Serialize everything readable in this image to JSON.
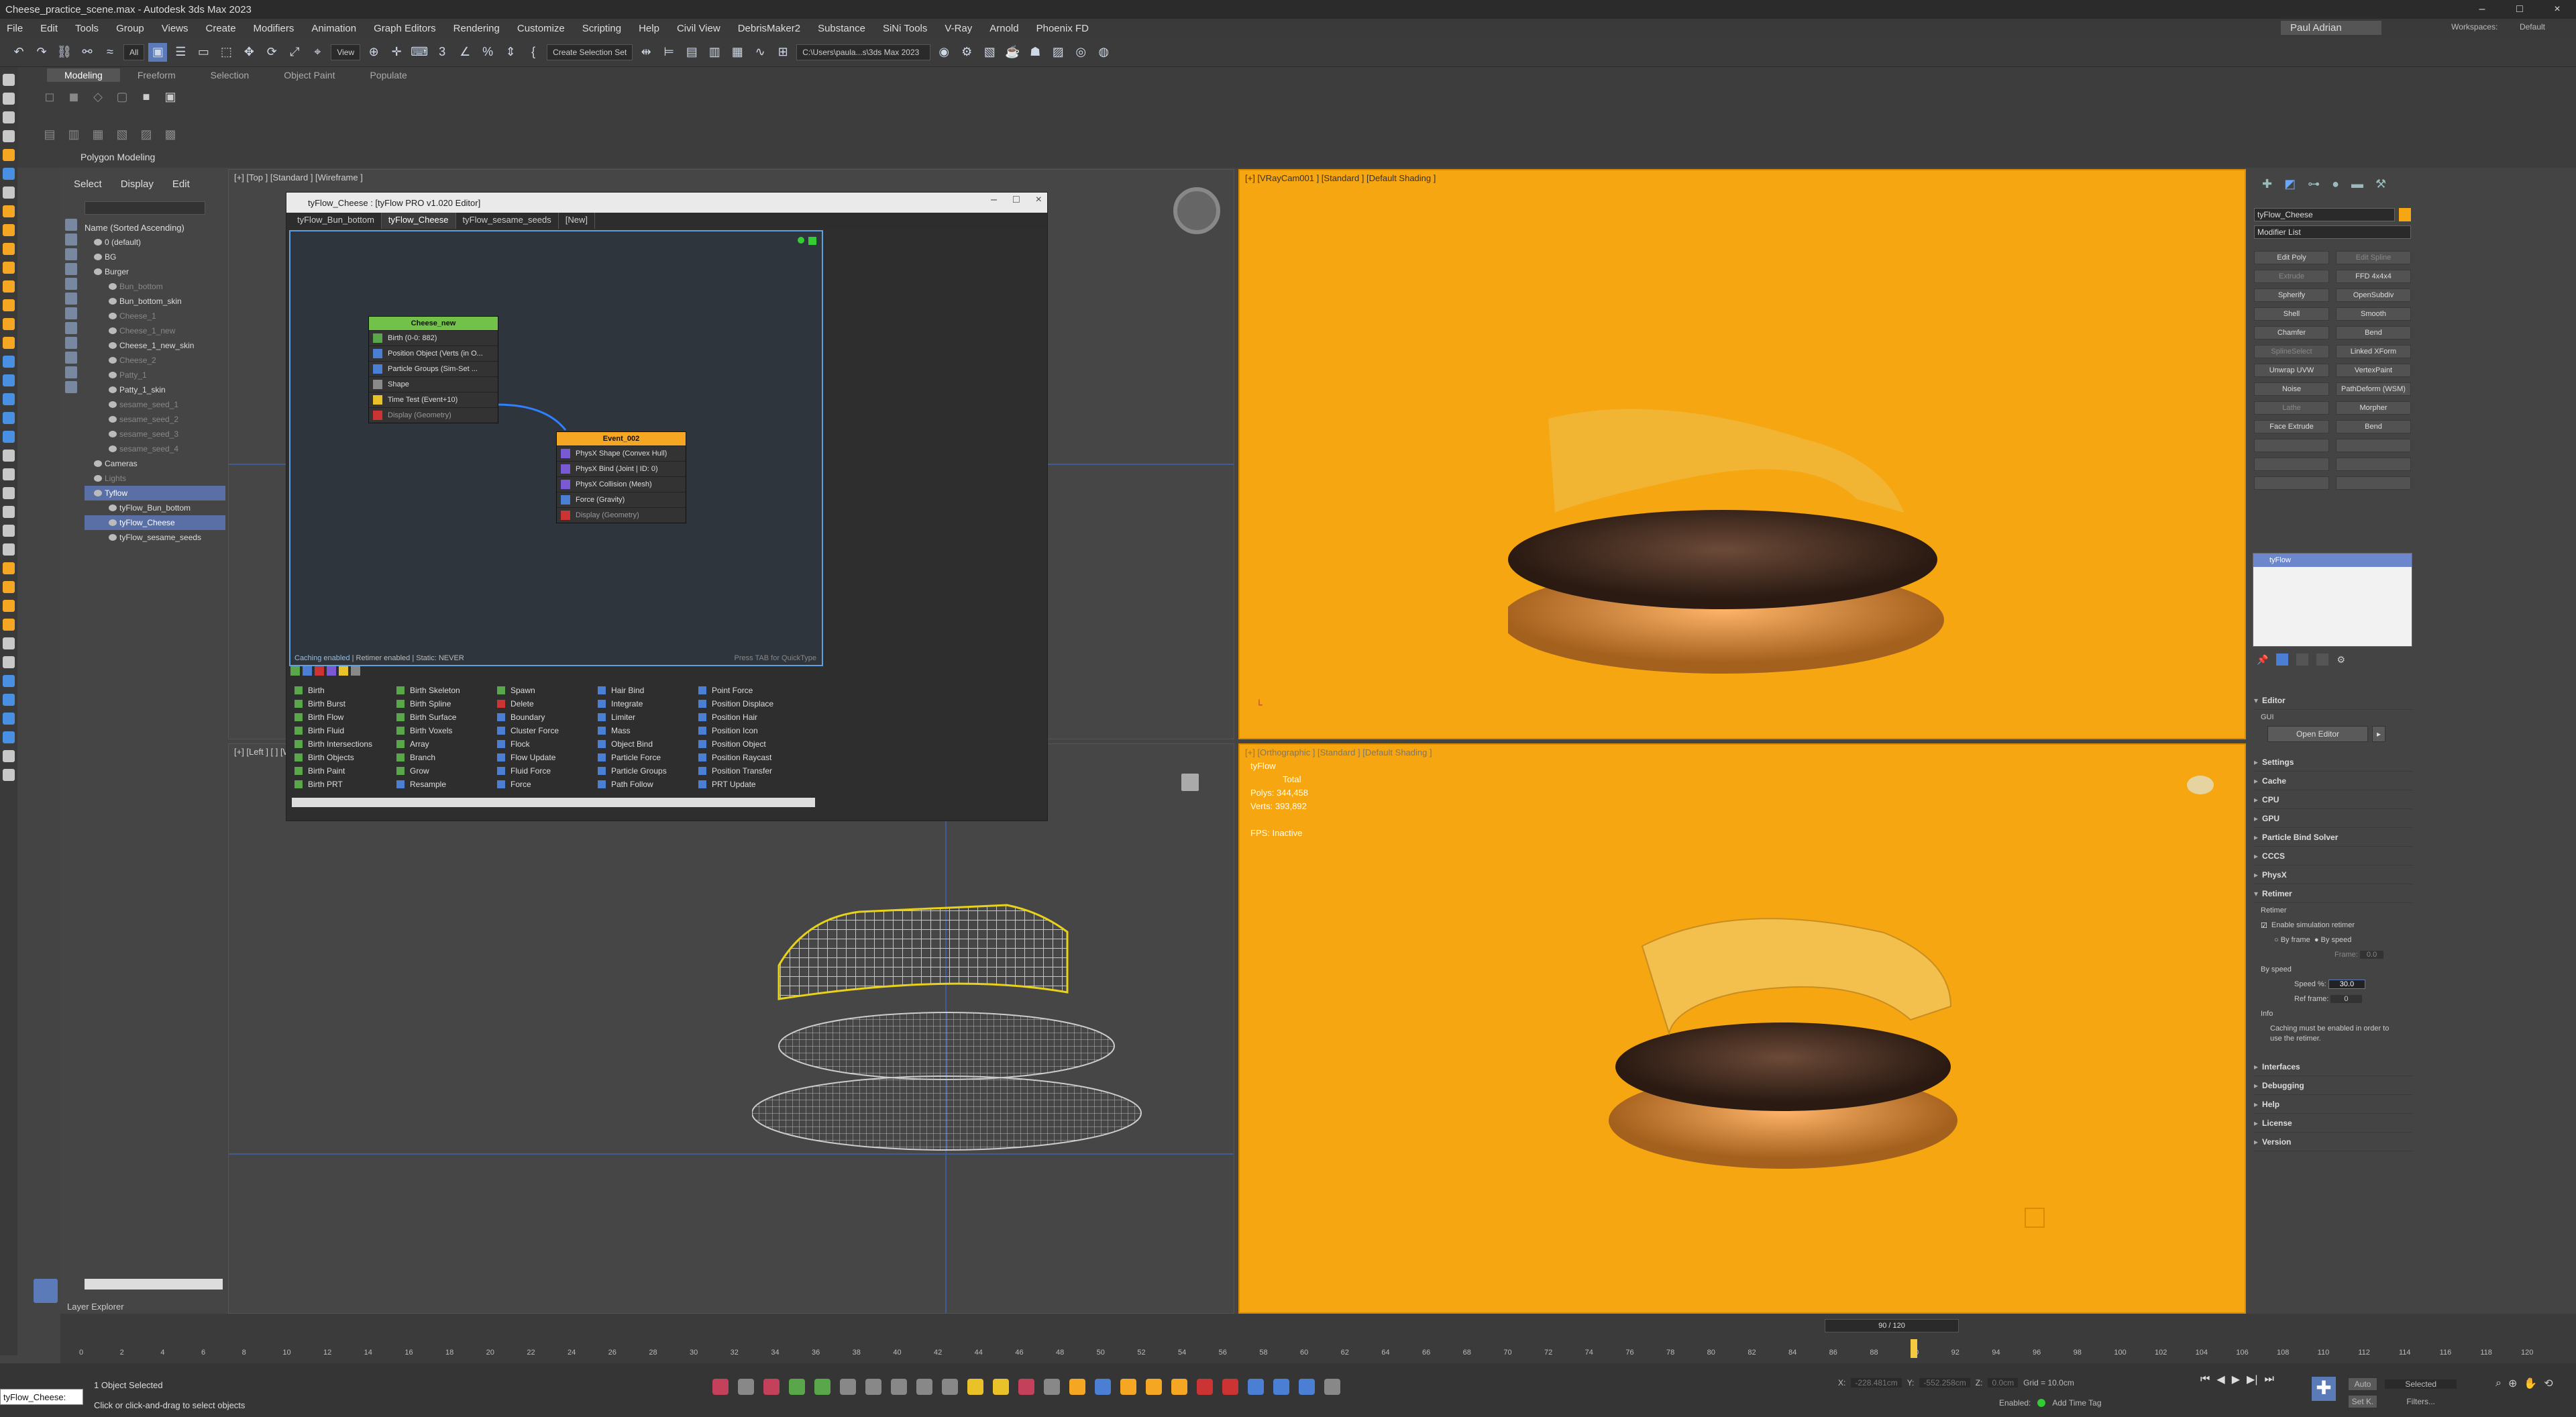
{
  "window_title": "Cheese_practice_scene.max - Autodesk 3ds Max 2023",
  "window_controls": [
    "–",
    "□",
    "×"
  ],
  "menu": [
    "File",
    "Edit",
    "Tools",
    "Group",
    "Views",
    "Create",
    "Modifiers",
    "Animation",
    "Graph Editors",
    "Rendering",
    "Customize",
    "Scripting",
    "Help",
    "Civil View",
    "DebrisMaker2",
    "Substance",
    "SiNi Tools",
    "V-Ray",
    "Arnold",
    "Phoenix FD"
  ],
  "user": "Paul Adrian",
  "workspace_label": "Workspaces:",
  "workspace_value": "Default",
  "toolbar": {
    "filter": "All",
    "ref_coord": "View",
    "selection_set": "Create Selection Set",
    "project_path": "C:\\Users\\paula...s\\3ds Max 2023"
  },
  "ribbon": {
    "tabs": [
      "Modeling",
      "Freeform",
      "Selection",
      "Object Paint",
      "Populate"
    ],
    "group": "Polygon Modeling"
  },
  "scene_explorer": {
    "tabs": [
      "Select",
      "Display",
      "Edit"
    ],
    "header": "Name (Sorted Ascending)",
    "items": [
      {
        "label": "0 (default)",
        "state": "normal"
      },
      {
        "label": "BG",
        "state": "normal"
      },
      {
        "label": "Burger",
        "state": "normal"
      },
      {
        "label": "Bun_bottom",
        "state": "dim"
      },
      {
        "label": "Bun_bottom_skin",
        "state": "normal"
      },
      {
        "label": "Cheese_1",
        "state": "dim"
      },
      {
        "label": "Cheese_1_new",
        "state": "dim"
      },
      {
        "label": "Cheese_1_new_skin",
        "state": "normal"
      },
      {
        "label": "Cheese_2",
        "state": "dim"
      },
      {
        "label": "Patty_1",
        "state": "dim"
      },
      {
        "label": "Patty_1_skin",
        "state": "normal"
      },
      {
        "label": "sesame_seed_1",
        "state": "dim"
      },
      {
        "label": "sesame_seed_2",
        "state": "dim"
      },
      {
        "label": "sesame_seed_3",
        "state": "dim"
      },
      {
        "label": "sesame_seed_4",
        "state": "dim"
      },
      {
        "label": "Cameras",
        "state": "normal"
      },
      {
        "label": "Lights",
        "state": "dim"
      },
      {
        "label": "Tyflow",
        "state": "sel"
      },
      {
        "label": "tyFlow_Bun_bottom",
        "state": "normal"
      },
      {
        "label": "tyFlow_Cheese",
        "state": "sel"
      },
      {
        "label": "tyFlow_sesame_seeds",
        "state": "normal"
      }
    ],
    "footer": "Layer Explorer"
  },
  "viewports": {
    "top": "[+] [Top ] [Standard ] [Wireframe ]",
    "camera": "[+] [VRayCam001 ] [Standard ] [Default Shading ]",
    "left": "[+] [Left ] [ ] [Wireframe ]",
    "ortho": "[+] [Orthographic ] [Standard ] [Default Shading ]",
    "stats": {
      "object": "tyFlow",
      "total": "Total",
      "polys": "Polys: 344,458",
      "verts": "Verts: 393,892",
      "fps": "FPS:  Inactive"
    }
  },
  "tyflow_editor": {
    "title": "tyFlow_Cheese : [tyFlow PRO v1.020 Editor]",
    "tabs": [
      "tyFlow_Bun_bottom",
      "tyFlow_Cheese",
      "tyFlow_sesame_seeds",
      "[New]"
    ],
    "node1": {
      "title": "Cheese_new",
      "ops": [
        "Birth (0-0: 882)",
        "Position Object (Verts (in O...",
        "Particle Groups (Sim-Set ...",
        "Shape",
        "Time Test (Event+10)",
        "Display (Geometry)"
      ]
    },
    "node2": {
      "title": "Event_002",
      "ops": [
        "PhysX Shape (Convex Hull)",
        "PhysX Bind (Joint | ID: 0)",
        "PhysX Collision (Mesh)",
        "Force (Gravity)",
        "Display (Geometry)"
      ]
    },
    "status_caching": "Caching enabled",
    "status_rest": "| Retimer enabled | Static: NEVER",
    "hint": "Press TAB for QuickType",
    "operators": [
      [
        "Birth",
        "Birth Burst",
        "Birth Flow",
        "Birth Fluid",
        "Birth Intersections",
        "Birth Objects",
        "Birth Paint",
        "Birth PRT"
      ],
      [
        "Birth Skeleton",
        "Birth Spline",
        "Birth Surface",
        "Birth Voxels",
        "Array",
        "Branch",
        "Grow",
        "Resample"
      ],
      [
        "Spawn",
        "Delete",
        "Boundary",
        "Cluster Force",
        "Flock",
        "Flow Update",
        "Fluid Force",
        "Force"
      ],
      [
        "Hair Bind",
        "Integrate",
        "Limiter",
        "Mass",
        "Object Bind",
        "Particle Force",
        "Particle Groups",
        "Path Follow"
      ],
      [
        "Point Force",
        "Position Displace",
        "Position Hair",
        "Position Icon",
        "Position Object",
        "Position Raycast",
        "Position Transfer",
        "PRT Update"
      ]
    ]
  },
  "command_panel": {
    "object_name": "tyFlow_Cheese",
    "modifier_list": "Modifier List",
    "modifier_buttons": [
      "Edit Poly",
      "Edit Spline",
      "Extrude",
      "FFD 4x4x4",
      "Spherify",
      "OpenSubdiv",
      "Shell",
      "Smooth",
      "Chamfer",
      "Bend",
      "SplineSelect",
      "Linked XForm",
      "Unwrap UVW",
      "VertexPaint",
      "Noise",
      "PathDeform (WSM)",
      "Lathe",
      "Morpher",
      "Face Extrude",
      "Bend"
    ],
    "dim_buttons": [
      "Edit Spline",
      "Extrude",
      "SplineSelect",
      "Lathe"
    ],
    "stack_item": "tyFlow",
    "rollouts_top": [
      "Editor"
    ],
    "gui_label": "GUI",
    "open_editor": "Open Editor",
    "rollouts": [
      "Settings",
      "Cache",
      "CPU",
      "GPU",
      "Particle Bind Solver",
      "CCCS",
      "PhysX",
      "Retimer"
    ],
    "retimer": {
      "label": "Retimer",
      "enable": "Enable simulation retimer",
      "by_frame": "By frame",
      "by_speed": "By speed",
      "frame_label": "Frame:",
      "frame_value": "0.0",
      "section": "By speed",
      "speed_label": "Speed %:",
      "speed_value": "30.0",
      "ref_label": "Ref frame:",
      "ref_value": "0",
      "info_label": "Info",
      "info": "Caching must be enabled in order to use the retimer."
    },
    "rollouts_bottom": [
      "Interfaces",
      "Debugging",
      "Help",
      "License",
      "Version"
    ]
  },
  "timeline": {
    "frame_display": "90 / 120",
    "ticks": [
      "0",
      "2",
      "4",
      "6",
      "8",
      "10",
      "12",
      "14",
      "16",
      "18",
      "20",
      "22",
      "24",
      "26",
      "28",
      "30",
      "32",
      "34",
      "36",
      "38",
      "40",
      "42",
      "44",
      "46",
      "48",
      "50",
      "52",
      "54",
      "56",
      "58",
      "60",
      "62",
      "64",
      "66",
      "68",
      "70",
      "72",
      "74",
      "76",
      "78",
      "80",
      "82",
      "84",
      "86",
      "88",
      "90",
      "92",
      "94",
      "96",
      "98",
      "100",
      "102",
      "104",
      "106",
      "108",
      "110",
      "112",
      "114",
      "116",
      "118",
      "120"
    ]
  },
  "status": {
    "maxscript": "tyFlow_Cheese:",
    "selected": "1 Object Selected",
    "prompt": "Click or click-and-drag to select objects",
    "x_label": "X:",
    "x_value": "-228.481cm",
    "y_label": "Y:",
    "y_value": "-552.258cm",
    "z_label": "Z:",
    "z_value": "0.0cm",
    "grid": "Grid = 10.0cm",
    "enabled": "Enabled:",
    "add_time_tag": "Add Time Tag",
    "auto": "Auto",
    "set_k": "Set K.",
    "selected_dd": "Selected",
    "filters": "Filters..."
  }
}
